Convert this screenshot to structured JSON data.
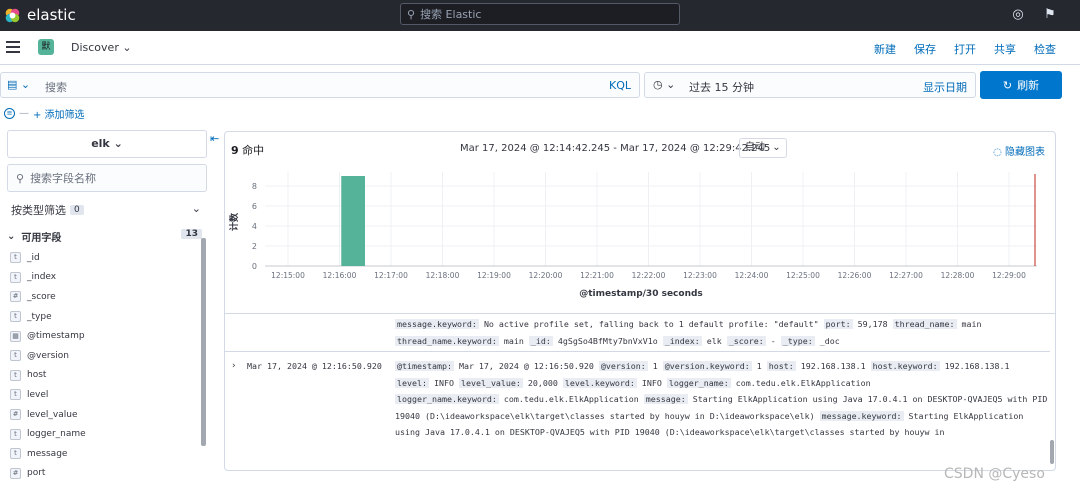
{
  "topbar": {
    "brand": "elastic",
    "search_placeholder": "搜索 Elastic"
  },
  "header": {
    "space_badge": "默",
    "app_title": "Discover",
    "actions": [
      "新建",
      "保存",
      "打开",
      "共享",
      "检查"
    ]
  },
  "querybar": {
    "query_placeholder": "搜索",
    "language": "KQL",
    "time_range": "过去 15 分钟",
    "show_dates": "显示日期",
    "refresh_label": "刷新"
  },
  "filters": {
    "add_filter": "+ 添加筛选"
  },
  "sidebar": {
    "index_pattern": "elk",
    "field_search_placeholder": "搜索字段名称",
    "type_filter_label": "按类型筛选",
    "type_filter_count": "0",
    "available_fields_label": "可用字段",
    "available_fields_count": "13",
    "fields": [
      {
        "type": "t",
        "name": "_id"
      },
      {
        "type": "t",
        "name": "_index"
      },
      {
        "type": "#",
        "name": "_score"
      },
      {
        "type": "t",
        "name": "_type"
      },
      {
        "type": "date",
        "name": "@timestamp"
      },
      {
        "type": "t",
        "name": "@version"
      },
      {
        "type": "t",
        "name": "host"
      },
      {
        "type": "t",
        "name": "level"
      },
      {
        "type": "#",
        "name": "level_value"
      },
      {
        "type": "t",
        "name": "logger_name"
      },
      {
        "type": "t",
        "name": "message"
      },
      {
        "type": "#",
        "name": "port"
      }
    ]
  },
  "main": {
    "hits_count": "9",
    "hits_label": "命中",
    "time_range_text": "Mar 17, 2024 @ 12:14:42.245 - Mar 17, 2024 @ 12:29:42.245",
    "interval": "自动",
    "hide_chart": "隐藏图表"
  },
  "chart_data": {
    "type": "bar",
    "x": [
      "12:15:00",
      "12:16:00",
      "12:17:00",
      "12:18:00",
      "12:19:00",
      "12:20:00",
      "12:21:00",
      "12:22:00",
      "12:23:00",
      "12:24:00",
      "12:25:00",
      "12:26:00",
      "12:27:00",
      "12:28:00",
      "12:29:00"
    ],
    "bars": [
      {
        "x": "12:16:30",
        "value": 9
      }
    ],
    "yticks": [
      0,
      2,
      4,
      6,
      8
    ],
    "ylim": [
      0,
      9
    ],
    "xlabel": "@timestamp/30 seconds",
    "ylabel": "计数",
    "color": "#54b399"
  },
  "docs": {
    "prev_lines": [
      [
        [
          "message.keyword:",
          "No active profile set, falling back to 1 default profile: \"default\""
        ],
        [
          "port:",
          "59,178"
        ],
        [
          "thread_name:",
          "main"
        ]
      ],
      [
        [
          "thread_name.keyword:",
          "main"
        ],
        [
          "_id:",
          "4gSgSo4BfMty7bnVxV1o"
        ],
        [
          "_index:",
          "elk"
        ],
        [
          "_score:",
          " - "
        ],
        [
          "_type:",
          "_doc"
        ]
      ]
    ],
    "row_time": "Mar 17, 2024 @ 12:16:50.920",
    "row_lines": [
      [
        [
          "@timestamp:",
          "Mar 17, 2024 @ 12:16:50.920"
        ],
        [
          "@version:",
          "1"
        ],
        [
          "@version.keyword:",
          "1"
        ],
        [
          "host:",
          "192.168.138.1"
        ],
        [
          "host.keyword:",
          "192.168.138.1"
        ]
      ],
      [
        [
          "level:",
          "INFO"
        ],
        [
          "level_value:",
          "20,000"
        ],
        [
          "level.keyword:",
          "INFO"
        ],
        [
          "logger_name:",
          "com.tedu.elk.ElkApplication"
        ]
      ],
      [
        [
          "logger_name.keyword:",
          "com.tedu.elk.ElkApplication"
        ],
        [
          "message:",
          "Starting ElkApplication using Java 17.0.4.1 on DESKTOP-QVAJEQ5 with PID"
        ]
      ],
      [
        [
          "",
          "19040 (D:\\ideaworkspace\\elk\\target\\classes started by houyw in D:\\ideaworkspace\\elk)"
        ],
        [
          "message.keyword:",
          "Starting ElkApplication"
        ]
      ],
      [
        [
          "",
          "using Java 17.0.4.1 on DESKTOP-QVAJEQ5 with PID 19040 (D:\\ideaworkspace\\elk\\target\\classes started by houyw in"
        ]
      ]
    ]
  },
  "watermark": "CSDN @Cyeso"
}
